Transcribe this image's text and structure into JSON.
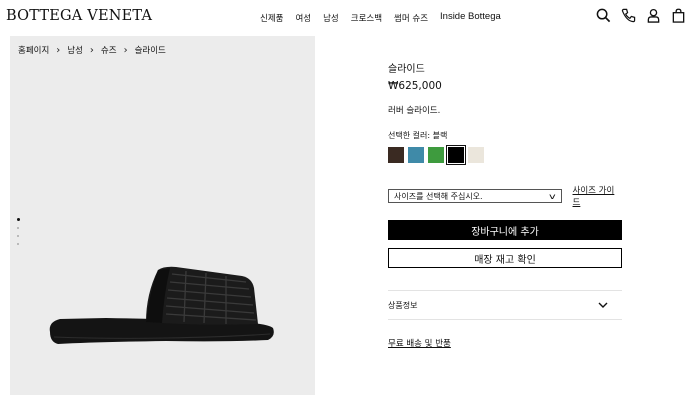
{
  "header": {
    "logo": "BOTTEGA VENETA",
    "nav": [
      "신제품",
      "여성",
      "남성",
      "크로스백",
      "썸머 슈즈",
      "Inside Bottega"
    ],
    "icons": [
      "search-icon",
      "phone-icon",
      "account-icon",
      "bag-icon"
    ]
  },
  "breadcrumb": [
    "홈페이지",
    "남성",
    "슈즈",
    "슬라이드"
  ],
  "gallery": {
    "slide_count": 4,
    "active_slide": 1
  },
  "product": {
    "title": "슬라이드",
    "price": "₩625,000",
    "description": "러버 슬라이드.",
    "color_label": "선택한 컬러: 블랙",
    "colors": [
      {
        "hex": "#3a2a22",
        "selected": false
      },
      {
        "hex": "#3f8aa8",
        "selected": false
      },
      {
        "hex": "#3e9b3e",
        "selected": false
      },
      {
        "hex": "#000000",
        "selected": true
      },
      {
        "hex": "#ebe6dc",
        "selected": false
      }
    ],
    "size_placeholder": "사이즈를 선택해 주십시오.",
    "size_guide": "사이즈 가이드",
    "add_to_cart": "장바구니에 추가",
    "check_stock": "매장 재고 확인",
    "product_info": "상품정보",
    "shipping": "무료 배송 및 반품"
  }
}
